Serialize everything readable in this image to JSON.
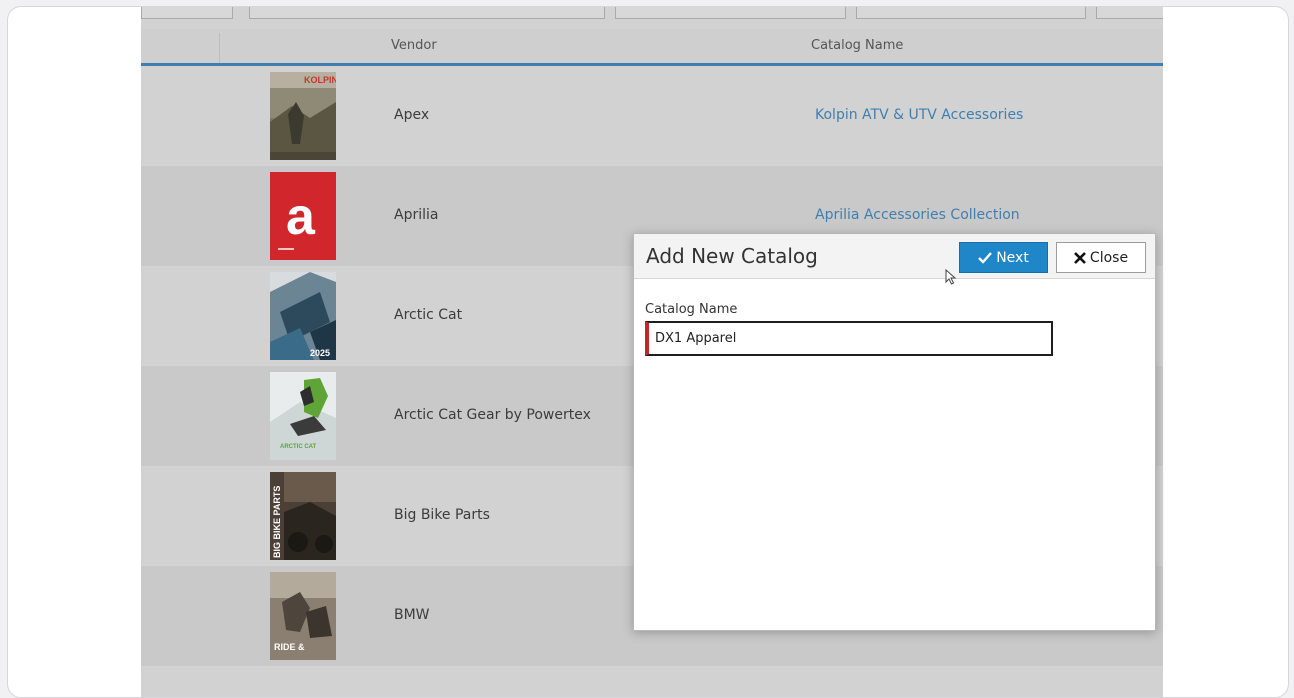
{
  "table": {
    "headers": {
      "vendor": "Vendor",
      "catalog_name": "Catalog Name"
    },
    "rows": [
      {
        "vendor": "Apex",
        "catalog": "Kolpin ATV & UTV Accessories",
        "thumb_text": "KOLPIN",
        "thumb_color": "#6e6a55"
      },
      {
        "vendor": "Aprilia",
        "catalog": "Aprilia Accessories Collection",
        "thumb_text": "a",
        "thumb_color": "#d0262c"
      },
      {
        "vendor": "Arctic Cat",
        "catalog": "",
        "thumb_text": "2025",
        "thumb_color": "#3e5e74"
      },
      {
        "vendor": "Arctic Cat Gear by Powertex",
        "catalog": "",
        "thumb_text": "ARCTIC CAT",
        "thumb_color": "#6fae3b"
      },
      {
        "vendor": "Big Bike Parts",
        "catalog": "",
        "thumb_text": "BIG BIKE PARTS",
        "thumb_color": "#4a3f37"
      },
      {
        "vendor": "BMW",
        "catalog": "",
        "thumb_text": "RIDE &",
        "thumb_color": "#7b6e5e"
      }
    ]
  },
  "modal": {
    "title": "Add New Catalog",
    "next_label": "Next",
    "close_label": "Close",
    "field_label": "Catalog Name",
    "field_value": "DX1 Apparel"
  },
  "colors": {
    "accent": "#1f86c8",
    "link": "#3f7fb0",
    "error_bar": "#c4262e"
  }
}
